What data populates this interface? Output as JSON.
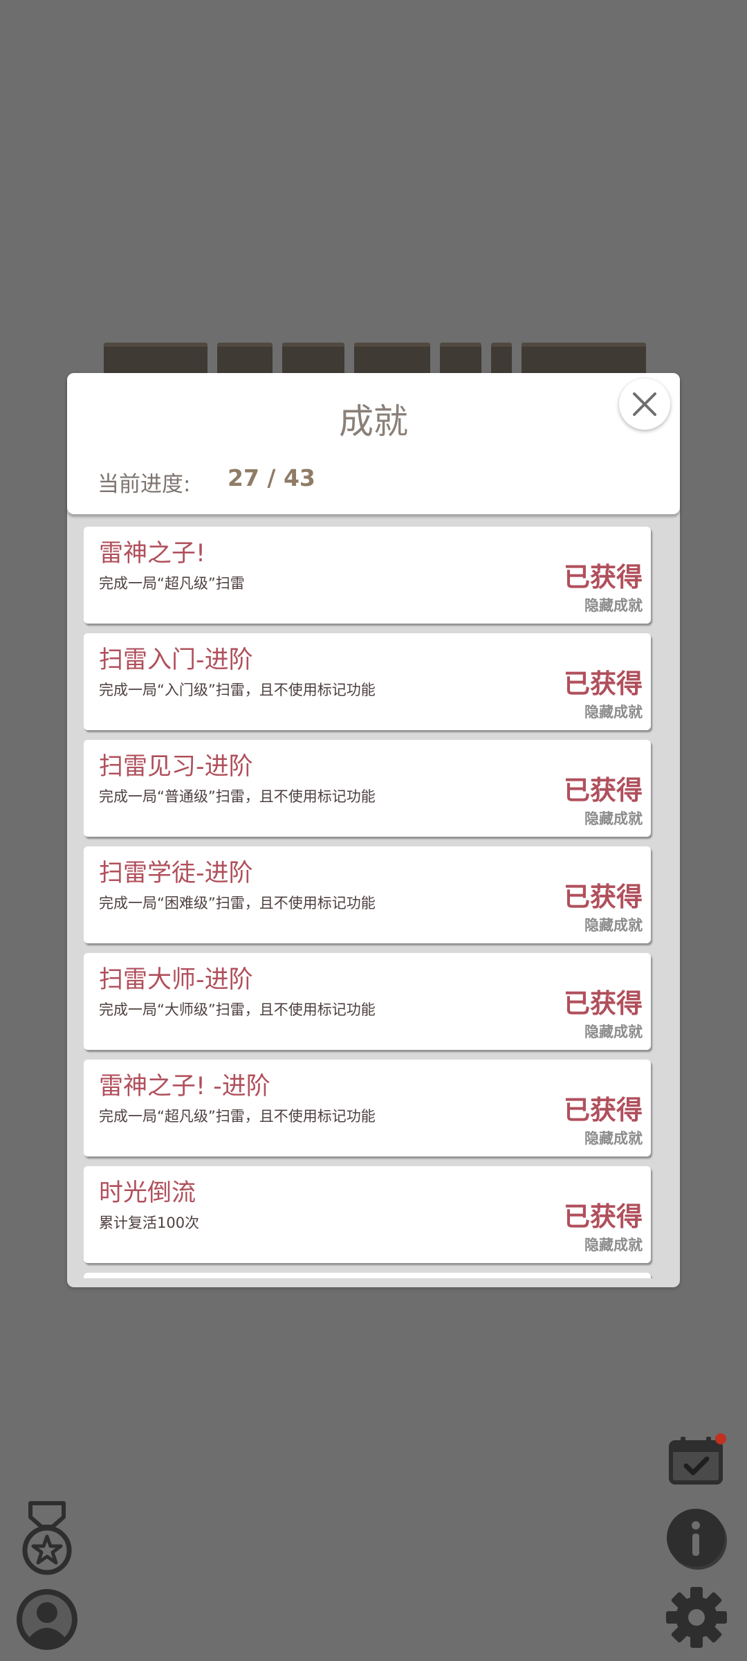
{
  "modal": {
    "title": "成就",
    "progress_label": "当前进度:",
    "progress_value": "27 / 43"
  },
  "achievements": [
    {
      "title": "雷神之子!",
      "desc": "完成一局“超凡级”扫雷",
      "status": "已获得",
      "tag": "隐藏成就"
    },
    {
      "title": "扫雷入门-进阶",
      "desc": "完成一局“入门级”扫雷，且不使用标记功能",
      "status": "已获得",
      "tag": "隐藏成就"
    },
    {
      "title": "扫雷见习-进阶",
      "desc": "完成一局“普通级”扫雷，且不使用标记功能",
      "status": "已获得",
      "tag": "隐藏成就"
    },
    {
      "title": "扫雷学徒-进阶",
      "desc": "完成一局“困难级”扫雷，且不使用标记功能",
      "status": "已获得",
      "tag": "隐藏成就"
    },
    {
      "title": "扫雷大师-进阶",
      "desc": "完成一局“大师级”扫雷，且不使用标记功能",
      "status": "已获得",
      "tag": "隐藏成就"
    },
    {
      "title": "雷神之子! -进阶",
      "desc": "完成一局“超凡级”扫雷，且不使用标记功能",
      "status": "已获得",
      "tag": "隐藏成就"
    },
    {
      "title": "时光倒流",
      "desc": "累计复活100次",
      "status": "已获得",
      "tag": "隐藏成就"
    }
  ],
  "icons": {
    "close": "close-icon",
    "medal": "medal-icon",
    "profile": "user-icon",
    "calendar": "calendar-check-icon",
    "info": "info-icon",
    "settings": "gear-icon"
  },
  "colors": {
    "background": "#6e6e6e",
    "accent": "#b0505c",
    "progress": "#8f7c66",
    "notification": "#c0311f"
  }
}
